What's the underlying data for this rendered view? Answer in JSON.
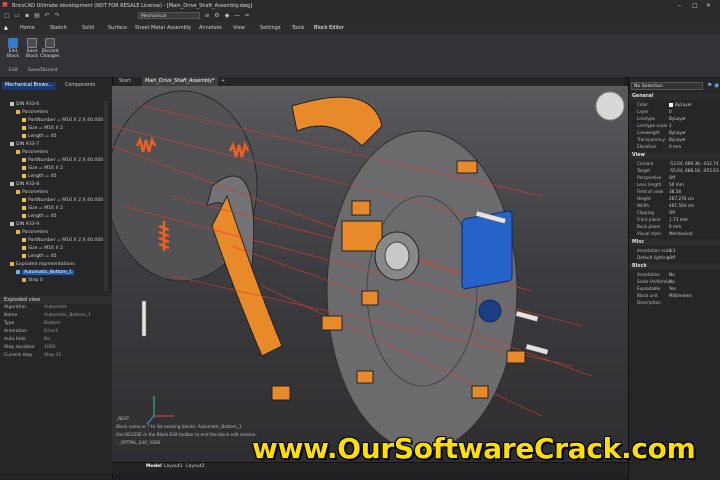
{
  "app": {
    "title": "BricsCAD Ultimate development (NOT FOR RESALE License) - [Main_Drive_Shaft_Assembly.dwg]",
    "workspace": "Mechanical"
  },
  "ribbon": {
    "tabs": [
      "Home",
      "Sketch",
      "Solid",
      "Surface",
      "Sheet Metal",
      "Assembly",
      "Annotate",
      "View",
      "Settings",
      "Tools",
      "Block Editor"
    ],
    "active_tab": "Block Editor",
    "buttons": [
      {
        "label": "Edit Block",
        "icon": "edit-block-icon"
      },
      {
        "label": "Save Block",
        "icon": "save-block-icon"
      },
      {
        "label": "Discard Changes",
        "icon": "discard-changes-icon"
      }
    ],
    "groups": [
      "Edit",
      "Save/Discard"
    ]
  },
  "doc_tabs": [
    "Start",
    "Main_Drive_Shaft_Assembly*",
    "+"
  ],
  "left_panel": {
    "tabs": [
      "Mechanical Brows...",
      "Components"
    ],
    "tree": [
      {
        "indent": 1,
        "label": "DIN 933-6",
        "icon": "bolt-icon"
      },
      {
        "indent": 2,
        "label": "Parameters",
        "icon": "folder-icon"
      },
      {
        "indent": 3,
        "label": "PartNumber = M16 X 2 X 40.000",
        "icon": "param-icon"
      },
      {
        "indent": 3,
        "label": "Size = M16 X 2",
        "icon": "param-icon"
      },
      {
        "indent": 3,
        "label": "Length = 40",
        "icon": "param-icon"
      },
      {
        "indent": 1,
        "label": "DIN 933-7",
        "icon": "bolt-icon"
      },
      {
        "indent": 2,
        "label": "Parameters",
        "icon": "folder-icon"
      },
      {
        "indent": 3,
        "label": "PartNumber = M16 X 2 X 40.000",
        "icon": "param-icon"
      },
      {
        "indent": 3,
        "label": "Size = M16 X 2",
        "icon": "param-icon"
      },
      {
        "indent": 3,
        "label": "Length = 40",
        "icon": "param-icon"
      },
      {
        "indent": 1,
        "label": "DIN 933-8",
        "icon": "bolt-icon"
      },
      {
        "indent": 2,
        "label": "Parameters",
        "icon": "folder-icon"
      },
      {
        "indent": 3,
        "label": "PartNumber = M16 X 2 X 40.000",
        "icon": "param-icon"
      },
      {
        "indent": 3,
        "label": "Size = M16 X 2",
        "icon": "param-icon"
      },
      {
        "indent": 3,
        "label": "Length = 40",
        "icon": "param-icon"
      },
      {
        "indent": 1,
        "label": "DIN 933-9",
        "icon": "bolt-icon"
      },
      {
        "indent": 2,
        "label": "Parameters",
        "icon": "folder-icon"
      },
      {
        "indent": 3,
        "label": "PartNumber = M16 X 2 X 40.000",
        "icon": "param-icon"
      },
      {
        "indent": 3,
        "label": "Size = M16 X 2",
        "icon": "param-icon"
      },
      {
        "indent": 3,
        "label": "Length = 40",
        "icon": "param-icon"
      },
      {
        "indent": 1,
        "label": "Exploded representations",
        "icon": "folder-icon"
      },
      {
        "indent": 2,
        "label": "Automatic_Bottom_1",
        "icon": "explode-icon",
        "selected": true
      },
      {
        "indent": 3,
        "label": "Step 0",
        "icon": "step-icon"
      }
    ],
    "exploded_view": {
      "title": "Exploded view",
      "rows": [
        {
          "k": "Algorithm",
          "v": "Automatic"
        },
        {
          "k": "Name",
          "v": "Automatic_Bottom_1"
        },
        {
          "k": "Type",
          "v": "Bottom"
        },
        {
          "k": "Animation",
          "v": "Direct"
        },
        {
          "k": "Auto hide",
          "v": "No"
        },
        {
          "k": "Step duration",
          "v": "1000"
        },
        {
          "k": "Current step",
          "v": "Step 31"
        }
      ]
    }
  },
  "command_panel": {
    "lines": [
      "_NEXT",
      "Block name or ? to list existing blocks: Automatic_Bottom_1",
      "Use BCLOSE or the Block Edit toolbar to end the block edit session.",
      ": _OPTPAL_EXO_VIEW"
    ]
  },
  "status_bar": {
    "tabs": [
      "Model",
      "Layout1",
      "Layout2"
    ]
  },
  "right_panel": {
    "selection": "No Selection",
    "sections": [
      {
        "title": "General",
        "rows": [
          {
            "k": "Color",
            "v": "ByLayer",
            "swatch": "#ffffff"
          },
          {
            "k": "Layer",
            "v": "0"
          },
          {
            "k": "Linetype",
            "v": "ByLayer"
          },
          {
            "k": "Linetype scale",
            "v": "1"
          },
          {
            "k": "Lineweight",
            "v": "ByLayer"
          },
          {
            "k": "Transparency",
            "v": "ByLayer"
          },
          {
            "k": "Elevation",
            "v": "0 mm"
          }
        ]
      },
      {
        "title": "View",
        "rows": [
          {
            "k": "Camera",
            "v": "-53.04, 689.38, -632.74"
          },
          {
            "k": "Target",
            "v": "-55.64, 688.18, -655.63"
          },
          {
            "k": "Perspective",
            "v": "Off"
          },
          {
            "k": "Lens length",
            "v": "50 mm"
          },
          {
            "k": "Field of view",
            "v": "38.58"
          },
          {
            "k": "Height",
            "v": "267.276 cm"
          },
          {
            "k": "Width",
            "v": "461.504 cm"
          },
          {
            "k": "Clipping",
            "v": "Off"
          },
          {
            "k": "Front plane",
            "v": "1.73 mm"
          },
          {
            "k": "Back plane",
            "v": "0 mm"
          },
          {
            "k": "Visual style",
            "v": "Mechanical"
          }
        ]
      },
      {
        "title": "Misc",
        "rows": [
          {
            "k": "Annotation scale",
            "v": "1:1"
          },
          {
            "k": "Default lighting",
            "v": "Off"
          }
        ]
      },
      {
        "title": "Block",
        "rows": [
          {
            "k": "Annotative",
            "v": "No"
          },
          {
            "k": "Scale Uniformly",
            "v": "No"
          },
          {
            "k": "Explodable",
            "v": "Yes"
          },
          {
            "k": "Block unit",
            "v": "Millimeters"
          },
          {
            "k": "Description",
            "v": ""
          }
        ]
      }
    ]
  },
  "watermark": "www.OurSoftwareCrack.com",
  "colors": {
    "accent": "#e8892a",
    "selection": "#1f5aa6",
    "flange": "#2563c9"
  }
}
